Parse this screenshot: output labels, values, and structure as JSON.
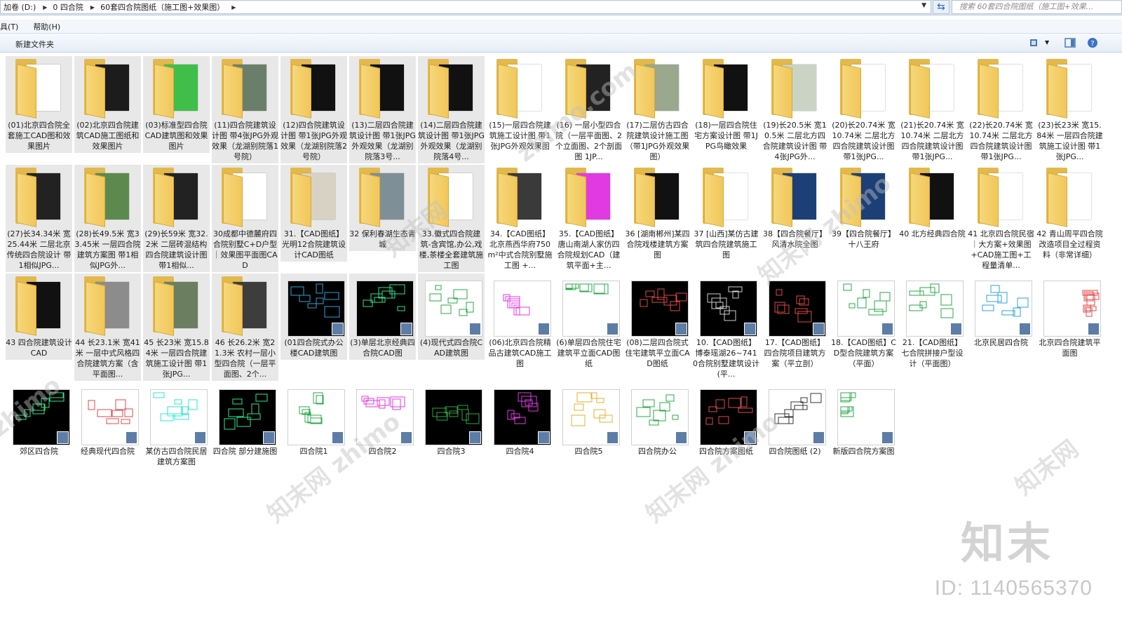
{
  "address": {
    "crumbs": [
      "加卷 (D:)",
      "0 四合院",
      "60套四合院图纸（施工图+效果图）"
    ],
    "search_placeholder": "搜索 60套四合院图纸（施工图+效果..."
  },
  "menu": [
    "具(T)",
    "帮助(H)"
  ],
  "toolbar": {
    "new_folder": "新建文件夹"
  },
  "items": [
    {
      "label": "(01)北京四合院全套施工CAD图和效果图片",
      "kind": "folder",
      "paper": "#ffffff",
      "sel": true
    },
    {
      "label": "(02)北京四合院建筑CAD施工图纸和效果图片",
      "kind": "folder",
      "paper": "#1c1c1c",
      "sel": true
    },
    {
      "label": "(03)标准型四合院CAD建筑图和效果图片",
      "kind": "folder",
      "paper": "#3fbf4a",
      "sel": true
    },
    {
      "label": "(11)四合院建筑设计图 带4张JPG外观效果（龙湖别院落1号院）",
      "kind": "folder",
      "paper": "#6a7f6a",
      "sel": true
    },
    {
      "label": "(12)四合院建筑设计图 带1张JPG外观效果（龙湖别院落2号院）",
      "kind": "folder",
      "paper": "#111111",
      "sel": true
    },
    {
      "label": "(13)二层四合院建筑设计图 带1张JPG外观效果（龙湖别院落3号...",
      "kind": "folder",
      "paper": "#111111",
      "sel": true
    },
    {
      "label": "(14)二层四合院建筑设计图 带1张JPG外观效果（龙湖别院落4号...",
      "kind": "folder",
      "paper": "#111111",
      "sel": true
    },
    {
      "label": "(15)一层四合院建筑施工设计图 带1张JPG外观效果图",
      "kind": "folder",
      "paper": "#ffffff",
      "sel": false
    },
    {
      "label": "(16) 一层小型四合院（一层平面图、2个立面图、2个剖面图 1JP...",
      "kind": "folder",
      "paper": "#222222",
      "sel": false
    },
    {
      "label": "(17)二层仿古四合院建筑设计施工图（带1JPG外观效果图）",
      "kind": "folder",
      "paper": "#9aa88e",
      "sel": false
    },
    {
      "label": "(18)一层四合院住宅方案设计图 带1JPG鸟瞰效果",
      "kind": "folder",
      "paper": "#111111",
      "sel": false
    },
    {
      "label": "(19)长20.5米 宽10.5米 二层北方四合院建筑设计图 带4张JPG外...",
      "kind": "folder",
      "paper": "#c9d4c4",
      "sel": false
    },
    {
      "label": "(20)长20.74米 宽10.74米 二层北方四合院建筑设计图 带1张JPG...",
      "kind": "folder",
      "paper": "#ffffff",
      "sel": false
    },
    {
      "label": "(21)长20.74米 宽10.74米 二层北方四合院建筑设计图 带1张JPG...",
      "kind": "folder",
      "paper": "#ffffff",
      "sel": false
    },
    {
      "label": "(22)长20.74米 宽10.74米 二层北方四合院建筑设计图 带1张JPG...",
      "kind": "folder",
      "paper": "#ffffff",
      "sel": false
    },
    {
      "label": "(23)长23米 宽15.84米 一层四合院建筑施工设计图 带1张JPG...",
      "kind": "folder",
      "paper": "#ffffff",
      "sel": false
    },
    {
      "label": "(27)长34.34米 宽25.44米 二层北京传统四合院设计 带1相似JPG...",
      "kind": "folder",
      "paper": "#222222",
      "sel": true
    },
    {
      "label": "(28)长49.5米 宽33.45米 一层四合院建筑方案图 带1相似JPG外...",
      "kind": "folder",
      "paper": "#5c8a4e",
      "sel": true
    },
    {
      "label": "(29)长59米 宽32.2米 二层砖混结构四合院建筑设计图 带1相似...",
      "kind": "folder",
      "paper": "#222222",
      "sel": true
    },
    {
      "label": "30成都中德麓府四合院别墅C+D户型｜效果图平面图CAD",
      "kind": "folder",
      "paper": "#ffffff",
      "sel": true
    },
    {
      "label": "31.【CAD图纸】光明12合院建筑设计CAD图纸",
      "kind": "folder",
      "paper": "#d8d2c4",
      "sel": true
    },
    {
      "label": "32 保利春湖生态青城",
      "kind": "folder",
      "paper": "#7f8f97",
      "sel": true
    },
    {
      "label": "33.徽式四合院建筑-含宾馆,办公,戏楼,茶楼全套建筑施工图",
      "kind": "folder",
      "paper": "#ffffff",
      "sel": true
    },
    {
      "label": "34.【CAD图纸】北京燕西华府750m²中式合院别墅施工图 +...",
      "kind": "folder",
      "paper": "#3a3a3a",
      "sel": false
    },
    {
      "label": "35.【CAD图纸】唐山南湖人家仿四合院规划CAD（建筑平面+主...",
      "kind": "folder",
      "paper": "#e23ae2",
      "sel": false
    },
    {
      "label": "36 [湖南郴州]某四合院戏楼建筑方案图",
      "kind": "folder",
      "paper": "#111111",
      "sel": false
    },
    {
      "label": "37 [山西]某仿古建筑四合院建筑施工图",
      "kind": "folder",
      "paper": "#ffffff",
      "sel": false
    },
    {
      "label": "38【四合院餐厅】风清水院全图",
      "kind": "folder",
      "paper": "#1d3f77",
      "sel": false
    },
    {
      "label": "39【四合院餐厅】十八王府",
      "kind": "folder",
      "paper": "#1d3f77",
      "sel": false
    },
    {
      "label": "40 北方经典四合院",
      "kind": "folder",
      "paper": "#111111",
      "sel": false
    },
    {
      "label": "41 北京四合院民宿｜大方案+效果图+CAD施工图+工程量清单...",
      "kind": "folder",
      "paper": "#ffffff",
      "sel": false
    },
    {
      "label": "42 青山周平四合院改造项目全过程资料（非常详细）",
      "kind": "folder",
      "paper": "#ffffff",
      "sel": false
    },
    {
      "label": "43 四合院建筑设计 CAD",
      "kind": "folder",
      "paper": "#111111",
      "sel": true
    },
    {
      "label": "44 长23.1米 宽41米 一层中式风格四合院建筑方案（含平面图...",
      "kind": "folder",
      "paper": "#8c8c8c",
      "sel": true
    },
    {
      "label": "45 长23米 宽15.84米 一层四合院建筑施工设计图 带1张JPG...",
      "kind": "folder",
      "paper": "#6b7f60",
      "sel": true
    },
    {
      "label": "46 长26.2米 宽21.3米 农村一层小型四合院（一层平面图、2个...",
      "kind": "folder",
      "paper": "#3d3d3d",
      "sel": true
    },
    {
      "label": "(01四合院式办公楼CAD建筑图",
      "kind": "cad",
      "bg": "#000000",
      "ink": "#2aa6d8",
      "sel": true
    },
    {
      "label": "(3)单层北京经典四合院CAD图",
      "kind": "cad",
      "bg": "#000000",
      "ink": "#2ee88a",
      "sel": true
    },
    {
      "label": "(4)现代式四合院CAD建筑图",
      "kind": "cad",
      "bg": "#ffffff",
      "ink": "#2aa84a",
      "sel": true
    },
    {
      "label": "(06)北京四合院精品古建筑CAD施工图",
      "kind": "cad",
      "bg": "#ffffff",
      "ink": "#e23ae2",
      "sel": false
    },
    {
      "label": "(6)单层四合院住宅建筑平立面CAD图纸",
      "kind": "cad",
      "bg": "#ffffff",
      "ink": "#2aa84a",
      "sel": false
    },
    {
      "label": "(08)二层四合院式住宅建筑平立面CAD图纸",
      "kind": "cad",
      "bg": "#000000",
      "ink": "#e04848",
      "sel": false
    },
    {
      "label": "10.【CAD图纸】博泰瑶湖26~7410合院别墅建筑设计(平...",
      "kind": "cad",
      "bg": "#000000",
      "ink": "#cfcfcf",
      "sel": false
    },
    {
      "label": "17.【CAD图纸】四合院项目建筑方案（平立剖）",
      "kind": "cad",
      "bg": "#000000",
      "ink": "#e04848",
      "sel": false
    },
    {
      "label": "18.【CAD图纸】CD型合院建筑方案（平面）",
      "kind": "cad",
      "bg": "#ffffff",
      "ink": "#2aa84a",
      "sel": false
    },
    {
      "label": "21.【CAD图纸】七合院拼接户型设计（平面图）",
      "kind": "cad",
      "bg": "#ffffff",
      "ink": "#2aa84a",
      "sel": false
    },
    {
      "label": "北京民居四合院",
      "kind": "cad",
      "bg": "#ffffff",
      "ink": "#2aa6d8",
      "sel": false
    },
    {
      "label": "北京四合院建筑平面图",
      "kind": "cad",
      "bg": "#ffffff",
      "ink": "#e04848",
      "sel": false
    },
    {
      "label": "郊区四合院",
      "kind": "cad",
      "bg": "#000000",
      "ink": "#2ee88a",
      "sel": false
    },
    {
      "label": "经典现代四合院",
      "kind": "cad",
      "bg": "#ffffff",
      "ink": "#e04848",
      "sel": false
    },
    {
      "label": "某仿古四合院民居建筑方案图",
      "kind": "cad",
      "bg": "#ffffff",
      "ink": "#2ee8c8",
      "sel": false
    },
    {
      "label": "四合院 部分建施图",
      "kind": "cad",
      "bg": "#000000",
      "ink": "#2ee88a",
      "sel": false
    },
    {
      "label": "四合院1",
      "kind": "cad",
      "bg": "#ffffff",
      "ink": "#2aa84a",
      "sel": false
    },
    {
      "label": "四合院2",
      "kind": "cad",
      "bg": "#ffffff",
      "ink": "#e23ae2",
      "sel": false
    },
    {
      "label": "四合院3",
      "kind": "cad",
      "bg": "#000000",
      "ink": "#2aa84a",
      "sel": false
    },
    {
      "label": "四合院4",
      "kind": "cad",
      "bg": "#000000",
      "ink": "#e23ae2",
      "sel": false
    },
    {
      "label": "四合院5",
      "kind": "cad",
      "bg": "#ffffff",
      "ink": "#e0b030",
      "sel": false
    },
    {
      "label": "四合院办公",
      "kind": "cad",
      "bg": "#ffffff",
      "ink": "#2aa84a",
      "sel": false
    },
    {
      "label": "四合院方案图纸",
      "kind": "cad",
      "bg": "#000000",
      "ink": "#e04848",
      "sel": false
    },
    {
      "label": "四合院图纸 (2)",
      "kind": "cad",
      "bg": "#ffffff",
      "ink": "#333333",
      "sel": false
    },
    {
      "label": "新版四合院方案图",
      "kind": "cad",
      "bg": "#ffffff",
      "ink": "#2aa84a",
      "sel": false
    }
  ],
  "watermark": {
    "logo": "知末",
    "id": "ID: 1140565370"
  },
  "colors": {
    "folder": "#f1c75a",
    "selection": "#e8e8e8",
    "chrome": "#dfe9f5"
  }
}
